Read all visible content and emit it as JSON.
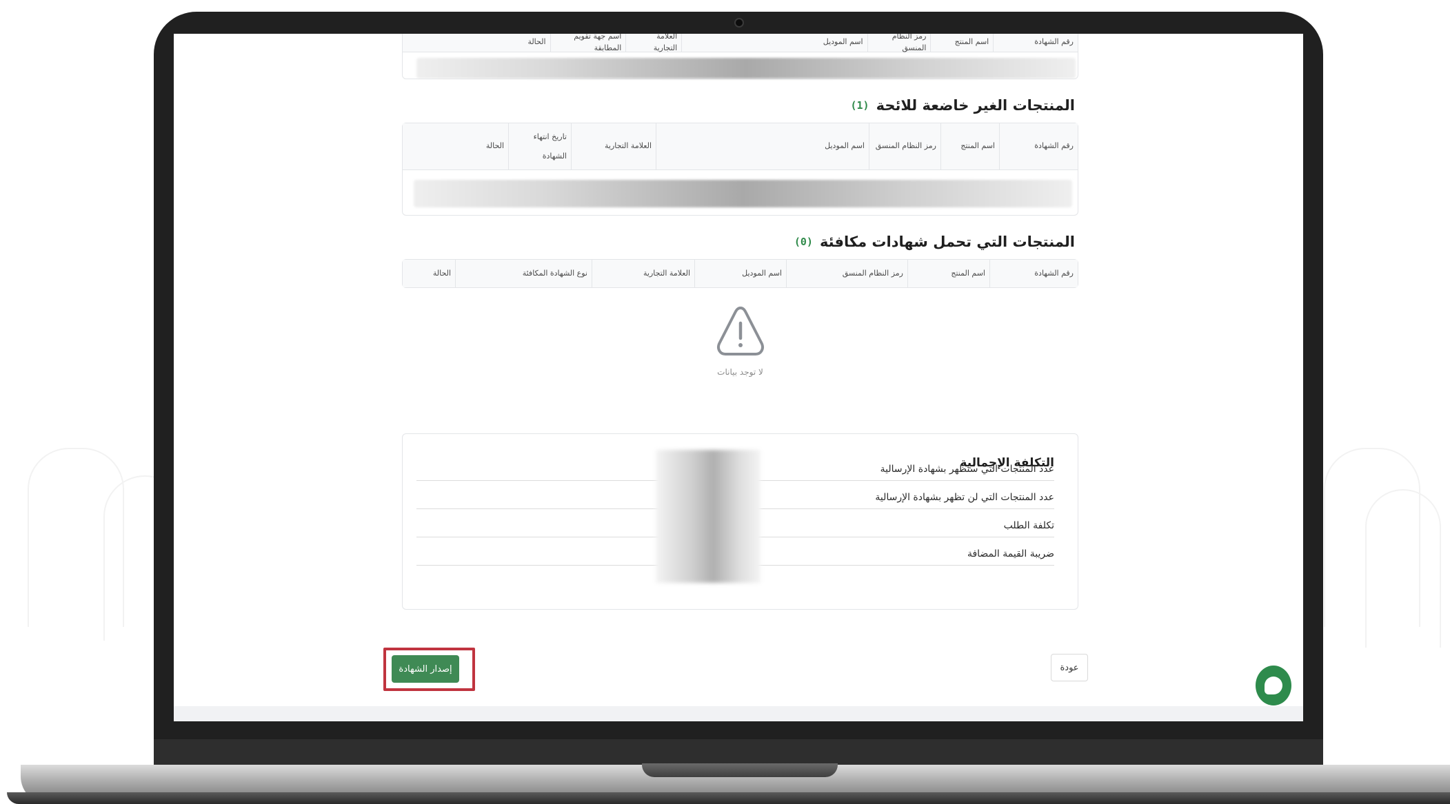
{
  "top_table": {
    "headers": [
      "رقم الشهادة",
      "اسم المنتج",
      "رمز النظام المنسق",
      "اسم الموديل",
      "العلامة التجارية",
      "اسم جهة تقويم المطابقة",
      "الحالة"
    ]
  },
  "non_regulated": {
    "title": "المنتجات الغير خاضعة للائحة",
    "count": "(1)",
    "headers": [
      "رقم الشهادة",
      "اسم المنتج",
      "رمز النظام المنسق",
      "اسم الموديل",
      "العلامة التجارية",
      "تاريخ انتهاء الشهادة",
      "الحالة"
    ]
  },
  "equivalent": {
    "title": "المنتجات التي تحمل شهادات مكافئة",
    "count": "(0)",
    "headers": [
      "رقم الشهادة",
      "اسم المنتج",
      "رمز النظام المنسق",
      "اسم الموديل",
      "العلامة التجارية",
      "نوع الشهادة المكافئة",
      "الحالة"
    ],
    "empty_text": "لا توجد بيانات"
  },
  "summary": {
    "title": "التكلفة الإجمالية",
    "rows": [
      "عدد المنتجات التي ستظهر بشهادة الإرسالية",
      "عدد المنتجات التي لن تظهر بشهادة الإرسالية",
      "تكلفة الطلب",
      "ضريبة القيمة المضافة"
    ]
  },
  "actions": {
    "back_label": "عودة",
    "issue_label": "إصدار الشهادة"
  },
  "colors": {
    "accent_green": "#3f8a55",
    "count_green": "#2f8a4a",
    "highlight_red": "#c0343f"
  },
  "icons": {
    "warning": "warning-triangle-icon",
    "chat": "chat-bubble-icon"
  }
}
